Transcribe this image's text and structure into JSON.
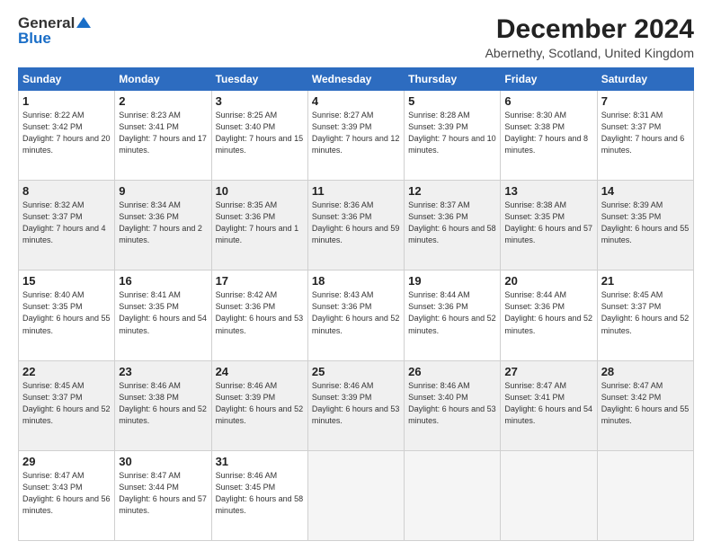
{
  "logo": {
    "line1": "General",
    "line2": "Blue"
  },
  "title": "December 2024",
  "subtitle": "Abernethy, Scotland, United Kingdom",
  "days_of_week": [
    "Sunday",
    "Monday",
    "Tuesday",
    "Wednesday",
    "Thursday",
    "Friday",
    "Saturday"
  ],
  "weeks": [
    [
      {
        "day": "1",
        "sunrise": "8:22 AM",
        "sunset": "3:42 PM",
        "daylight": "7 hours and 20 minutes."
      },
      {
        "day": "2",
        "sunrise": "8:23 AM",
        "sunset": "3:41 PM",
        "daylight": "7 hours and 17 minutes."
      },
      {
        "day": "3",
        "sunrise": "8:25 AM",
        "sunset": "3:40 PM",
        "daylight": "7 hours and 15 minutes."
      },
      {
        "day": "4",
        "sunrise": "8:27 AM",
        "sunset": "3:39 PM",
        "daylight": "7 hours and 12 minutes."
      },
      {
        "day": "5",
        "sunrise": "8:28 AM",
        "sunset": "3:39 PM",
        "daylight": "7 hours and 10 minutes."
      },
      {
        "day": "6",
        "sunrise": "8:30 AM",
        "sunset": "3:38 PM",
        "daylight": "7 hours and 8 minutes."
      },
      {
        "day": "7",
        "sunrise": "8:31 AM",
        "sunset": "3:37 PM",
        "daylight": "7 hours and 6 minutes."
      }
    ],
    [
      {
        "day": "8",
        "sunrise": "8:32 AM",
        "sunset": "3:37 PM",
        "daylight": "7 hours and 4 minutes."
      },
      {
        "day": "9",
        "sunrise": "8:34 AM",
        "sunset": "3:36 PM",
        "daylight": "7 hours and 2 minutes."
      },
      {
        "day": "10",
        "sunrise": "8:35 AM",
        "sunset": "3:36 PM",
        "daylight": "7 hours and 1 minute."
      },
      {
        "day": "11",
        "sunrise": "8:36 AM",
        "sunset": "3:36 PM",
        "daylight": "6 hours and 59 minutes."
      },
      {
        "day": "12",
        "sunrise": "8:37 AM",
        "sunset": "3:36 PM",
        "daylight": "6 hours and 58 minutes."
      },
      {
        "day": "13",
        "sunrise": "8:38 AM",
        "sunset": "3:35 PM",
        "daylight": "6 hours and 57 minutes."
      },
      {
        "day": "14",
        "sunrise": "8:39 AM",
        "sunset": "3:35 PM",
        "daylight": "6 hours and 55 minutes."
      }
    ],
    [
      {
        "day": "15",
        "sunrise": "8:40 AM",
        "sunset": "3:35 PM",
        "daylight": "6 hours and 55 minutes."
      },
      {
        "day": "16",
        "sunrise": "8:41 AM",
        "sunset": "3:35 PM",
        "daylight": "6 hours and 54 minutes."
      },
      {
        "day": "17",
        "sunrise": "8:42 AM",
        "sunset": "3:36 PM",
        "daylight": "6 hours and 53 minutes."
      },
      {
        "day": "18",
        "sunrise": "8:43 AM",
        "sunset": "3:36 PM",
        "daylight": "6 hours and 52 minutes."
      },
      {
        "day": "19",
        "sunrise": "8:44 AM",
        "sunset": "3:36 PM",
        "daylight": "6 hours and 52 minutes."
      },
      {
        "day": "20",
        "sunrise": "8:44 AM",
        "sunset": "3:36 PM",
        "daylight": "6 hours and 52 minutes."
      },
      {
        "day": "21",
        "sunrise": "8:45 AM",
        "sunset": "3:37 PM",
        "daylight": "6 hours and 52 minutes."
      }
    ],
    [
      {
        "day": "22",
        "sunrise": "8:45 AM",
        "sunset": "3:37 PM",
        "daylight": "6 hours and 52 minutes."
      },
      {
        "day": "23",
        "sunrise": "8:46 AM",
        "sunset": "3:38 PM",
        "daylight": "6 hours and 52 minutes."
      },
      {
        "day": "24",
        "sunrise": "8:46 AM",
        "sunset": "3:39 PM",
        "daylight": "6 hours and 52 minutes."
      },
      {
        "day": "25",
        "sunrise": "8:46 AM",
        "sunset": "3:39 PM",
        "daylight": "6 hours and 53 minutes."
      },
      {
        "day": "26",
        "sunrise": "8:46 AM",
        "sunset": "3:40 PM",
        "daylight": "6 hours and 53 minutes."
      },
      {
        "day": "27",
        "sunrise": "8:47 AM",
        "sunset": "3:41 PM",
        "daylight": "6 hours and 54 minutes."
      },
      {
        "day": "28",
        "sunrise": "8:47 AM",
        "sunset": "3:42 PM",
        "daylight": "6 hours and 55 minutes."
      }
    ],
    [
      {
        "day": "29",
        "sunrise": "8:47 AM",
        "sunset": "3:43 PM",
        "daylight": "6 hours and 56 minutes."
      },
      {
        "day": "30",
        "sunrise": "8:47 AM",
        "sunset": "3:44 PM",
        "daylight": "6 hours and 57 minutes."
      },
      {
        "day": "31",
        "sunrise": "8:46 AM",
        "sunset": "3:45 PM",
        "daylight": "6 hours and 58 minutes."
      },
      null,
      null,
      null,
      null
    ]
  ]
}
